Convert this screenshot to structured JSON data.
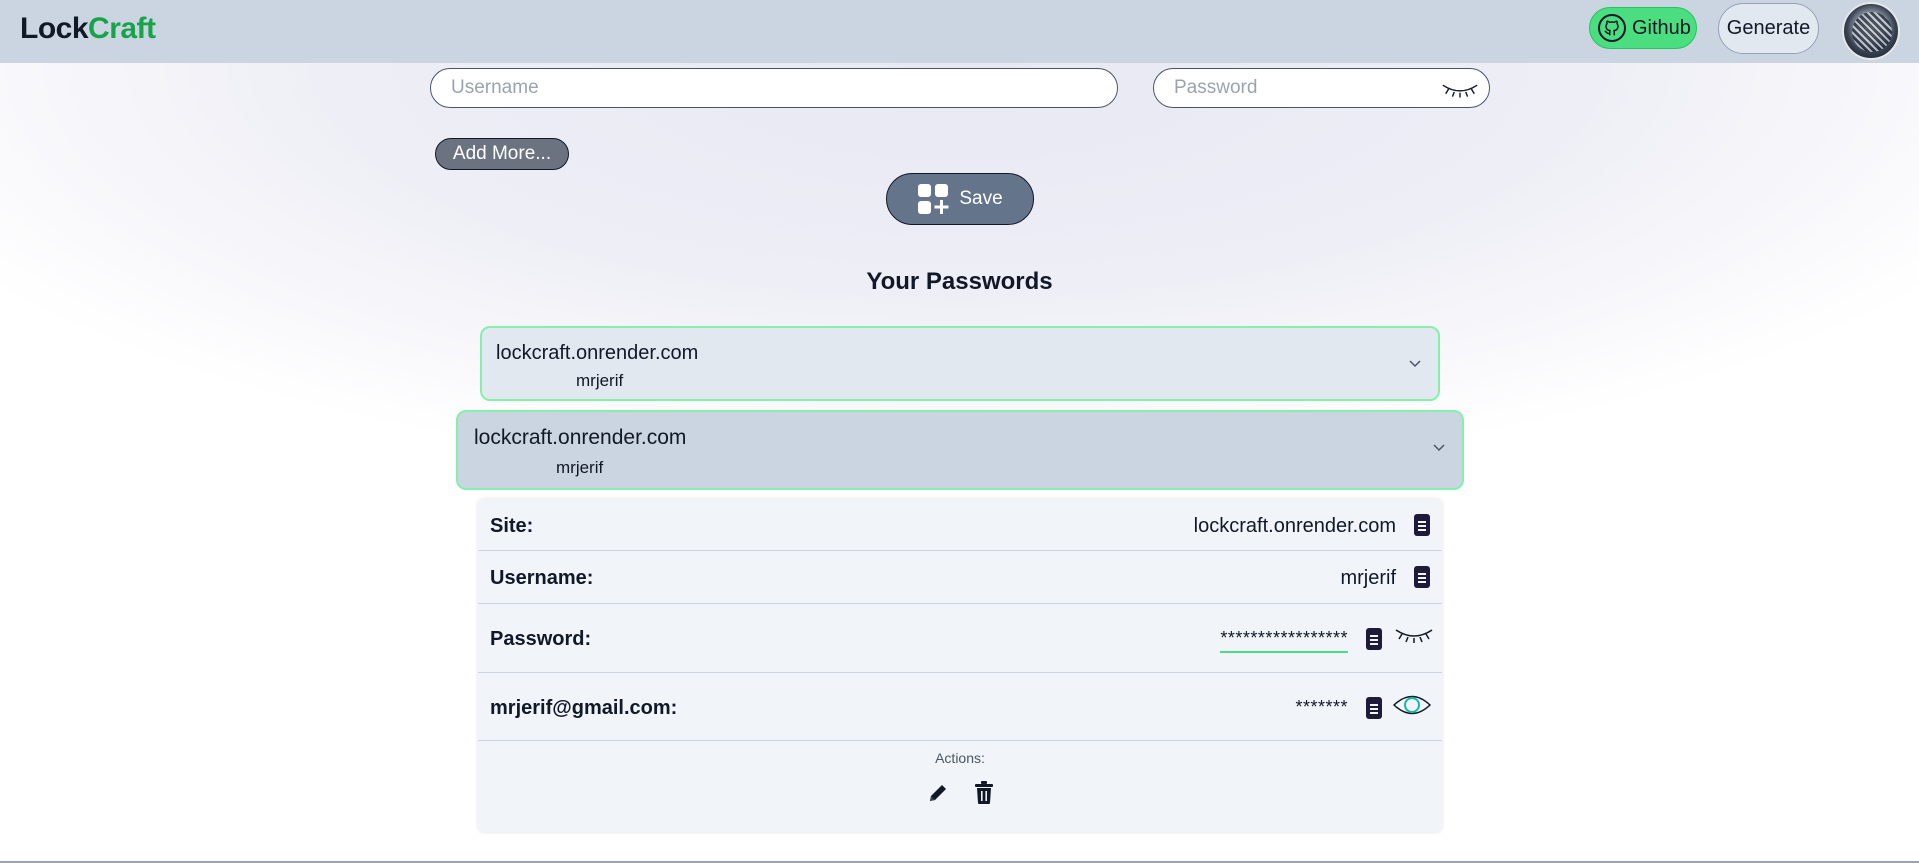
{
  "navbar": {
    "logo_part1": "Lock",
    "logo_part2": "Craft",
    "github_label": "Github",
    "generate_label": "Generate"
  },
  "form": {
    "username_placeholder": "Username",
    "password_placeholder": "Password",
    "add_more_label": "Add More...",
    "save_label": "Save"
  },
  "passwords": {
    "title": "Your Passwords",
    "entries": [
      {
        "site": "lockcraft.onrender.com",
        "username": "mrjerif"
      },
      {
        "site": "lockcraft.onrender.com",
        "username": "mrjerif"
      }
    ]
  },
  "details": {
    "site_label": "Site:",
    "site_value": "lockcraft.onrender.com",
    "username_label": "Username:",
    "username_value": "mrjerif",
    "password_label": "Password:",
    "password_value": "*****************",
    "extra_label": "mrjerif@gmail.com:",
    "extra_value": "*******",
    "actions_label": "Actions:"
  },
  "colors": {
    "navbar_bg": "#cbd5e1",
    "brand_green": "#16a34a",
    "github_green": "#4ade80",
    "card_border": "#86efac",
    "button_dark": "#64748b"
  },
  "icons": [
    "github-icon",
    "eye-closed-icon",
    "eye-open-icon",
    "copy-icon",
    "save-grid-icon",
    "chevron-down-icon",
    "edit-icon",
    "delete-icon"
  ]
}
